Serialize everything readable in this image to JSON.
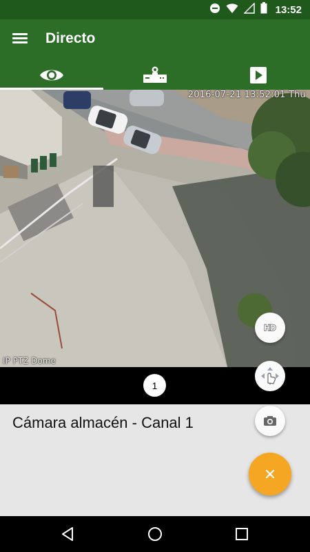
{
  "status_bar": {
    "time": "13:52",
    "icons": [
      "do-not-disturb-icon",
      "wifi-icon",
      "signal-icon",
      "battery-icon"
    ]
  },
  "app_bar": {
    "title": "Directo",
    "menu_icon": "menu-icon"
  },
  "tabs": [
    {
      "icon": "eye-icon",
      "selected": true
    },
    {
      "icon": "dvr-recorder-icon",
      "selected": false
    },
    {
      "icon": "play-icon",
      "selected": false
    }
  ],
  "video": {
    "timestamp": "2016-07-21 13:52:01 Thu",
    "camera_label": "IP PTZ Dome"
  },
  "pager": {
    "current_page": "1"
  },
  "camera": {
    "title": "Cámara almacén - Canal 1"
  },
  "fab": {
    "hd_label": "HD",
    "actions": [
      "hd-quality-icon",
      "ptz-control-icon",
      "snapshot-camera-icon"
    ],
    "main_icon": "close-icon"
  },
  "colors": {
    "status_bar": "#1f5a1c",
    "app_bar": "#2c6d27",
    "fab_accent": "#f5a623",
    "info_background": "#e6e6e6"
  },
  "nav_bar": {
    "buttons": [
      "back-icon",
      "home-icon",
      "recents-icon"
    ]
  }
}
